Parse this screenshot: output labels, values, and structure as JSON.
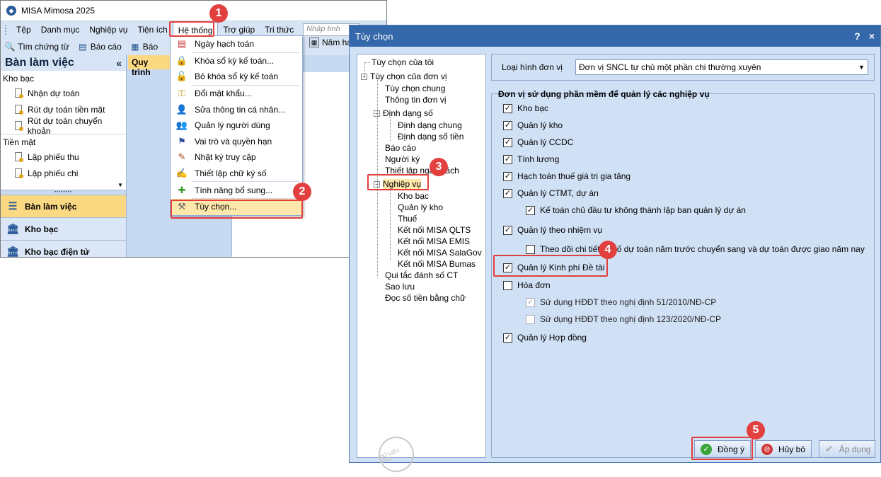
{
  "app": {
    "title": "MISA Mimosa 2025",
    "menu": [
      "Tệp",
      "Danh mục",
      "Nghiệp vụ",
      "Tiện ích",
      "Hệ thống",
      "Trợ giúp",
      "Tri thức"
    ],
    "search_placeholder": "Nhập tính",
    "toolbar": {
      "find_voucher": "Tìm chứng từ",
      "report": "Báo cáo",
      "report_short": "Báo",
      "year": "Năm hạ"
    },
    "left_panel": {
      "title": "Bàn làm việc",
      "groups": [
        {
          "label": "Kho bạc",
          "items": [
            "Nhận dự toán",
            "Rút dự toán tiền mặt",
            "Rút dự toán chuyển khoản"
          ]
        },
        {
          "label": "Tiền mặt",
          "items": [
            "Lập phiếu thu",
            "Lập phiếu chi"
          ]
        }
      ],
      "nav": [
        "Bàn làm việc",
        "Kho bạc",
        "Kho bạc điện tử"
      ]
    },
    "content_tab": "Quy trình",
    "system_menu": [
      "Ngày hạch toán",
      "Khóa sổ kỳ kế toán...",
      "Bỏ khóa sổ kỳ kế toán",
      "Đổi mật khẩu...",
      "Sửa thông tin cá nhân...",
      "Quản lý người dùng",
      "Vai trò và quyền hạn",
      "Nhật ký truy cập",
      "Thiết lập chữ ký số",
      "Tính năng bổ sung...",
      "Tùy chọn..."
    ]
  },
  "steps": [
    "1",
    "2",
    "3",
    "4",
    "5"
  ],
  "dialog": {
    "title": "Tùy chọn",
    "title_help": "?",
    "title_close": "×",
    "tree": [
      "Tùy chọn của tôi",
      "Tùy chọn của đơn vị",
      "Tùy chọn chung",
      "Thông tin đơn vị",
      "Định dạng số",
      "Định dạng chung",
      "Định dạng số tiền",
      "Báo cáo",
      "Người ký",
      "Thiết lập ngân sách",
      "Nghiệp vụ",
      "Kho bạc",
      "Quản lý kho",
      "Thuế",
      "Kết nối MISA QLTS",
      "Kết nối MISA EMIS",
      "Kết nối MISA SalaGov",
      "Kết nối MISA Bumas",
      "Qui tắc đánh số CT",
      "Sao lưu",
      "Đọc số tiền bằng chữ"
    ],
    "unit_type_label": "Loại hình đơn vị",
    "unit_type_value": "Đơn vị SNCL tự chủ một phần chi thường xuyên",
    "group_title": "Đơn vị sử dụng phần mềm để quản lý các nghiệp vụ",
    "options": [
      {
        "label": "Kho bạc",
        "checked": true
      },
      {
        "label": "Quản lý kho",
        "checked": true
      },
      {
        "label": "Quản lý CCDC",
        "checked": true
      },
      {
        "label": "Tính lương",
        "checked": true
      },
      {
        "label": "Hạch toán thuế giá trị gia tăng",
        "checked": true
      },
      {
        "label": "Quản lý CTMT, dự án",
        "checked": true
      },
      {
        "label": "Kế toán chủ đầu tư không thành lập ban quản lý dự án",
        "checked": true
      },
      {
        "label": "Quản lý theo nhiệm vụ",
        "checked": true
      },
      {
        "label": "Theo dõi chi tiết từ số dự toán năm trước chuyển sang và dự toán được giao năm nay",
        "checked": false
      },
      {
        "label": "Quản lý Kinh phí Đề tài",
        "checked": true
      },
      {
        "label": "Hóa đơn",
        "checked": false
      },
      {
        "label": "Sử dụng HĐĐT theo nghị định 51/2010/NĐ-CP",
        "checked": true,
        "disabled": true
      },
      {
        "label": "Sử dụng HĐĐT theo nghị định 123/2020/NĐ-CP",
        "checked": false,
        "disabled": true
      },
      {
        "label": "Quản lý Hợp đồng",
        "checked": true
      }
    ],
    "buttons": {
      "ok": "Đồng ý",
      "cancel": "Hủy bỏ",
      "apply": "Áp dụng"
    },
    "watermark": "DỮ LIỆU MẪU"
  },
  "colors": {
    "accent": "#3468aa",
    "highlight": "#e2403f",
    "selected": "#fbd882"
  }
}
